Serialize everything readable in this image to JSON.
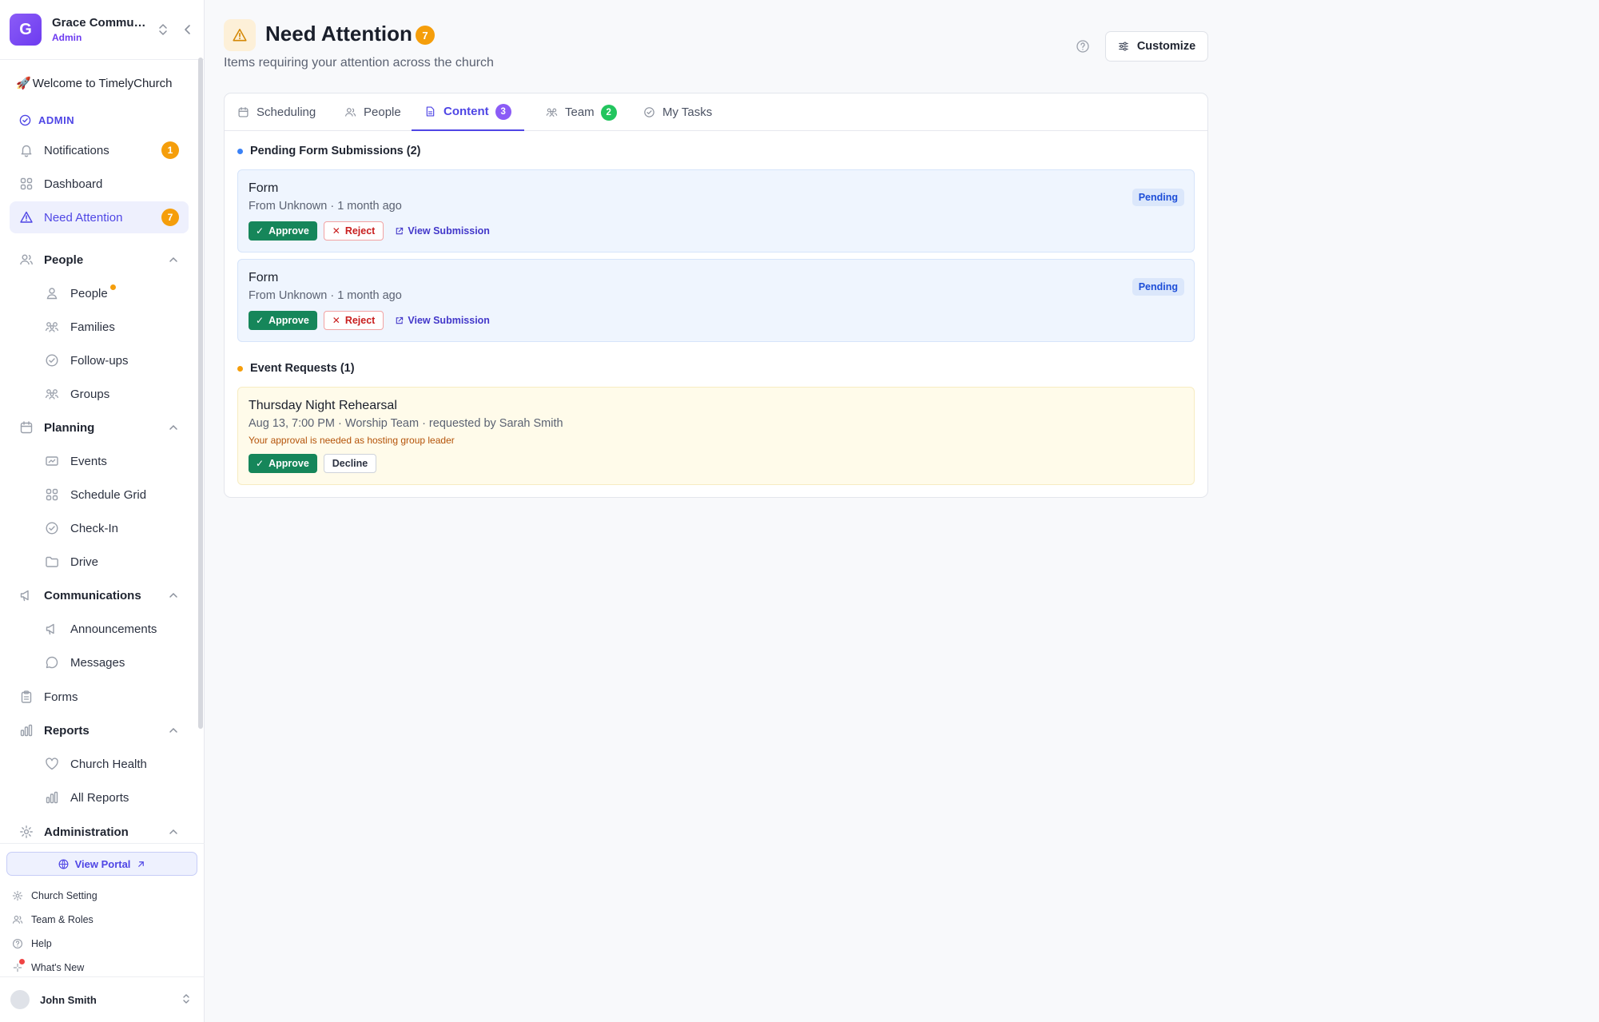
{
  "org": {
    "initial": "G",
    "name": "Grace Community Church",
    "role": "Admin"
  },
  "sidebar": {
    "welcome": "Welcome to TimelyChurch",
    "section_label": "ADMIN",
    "items": {
      "notifications": {
        "label": "Notifications",
        "badge": "1"
      },
      "dashboard": {
        "label": "Dashboard"
      },
      "need_attention": {
        "label": "Need Attention",
        "badge": "7"
      },
      "people_group": {
        "label": "People"
      },
      "people": {
        "label": "People"
      },
      "families": {
        "label": "Families"
      },
      "followups": {
        "label": "Follow-ups"
      },
      "groups": {
        "label": "Groups"
      },
      "planning_group": {
        "label": "Planning"
      },
      "events": {
        "label": "Events"
      },
      "schedule_grid": {
        "label": "Schedule Grid"
      },
      "checkin": {
        "label": "Check-In"
      },
      "drive": {
        "label": "Drive"
      },
      "communications_group": {
        "label": "Communications"
      },
      "announcements": {
        "label": "Announcements"
      },
      "messages": {
        "label": "Messages"
      },
      "forms": {
        "label": "Forms"
      },
      "reports_group": {
        "label": "Reports"
      },
      "church_health": {
        "label": "Church Health"
      },
      "all_reports": {
        "label": "All Reports"
      },
      "administration_group": {
        "label": "Administration"
      }
    },
    "footer": {
      "view_portal": "View Portal",
      "church_setting": "Church Setting",
      "team_roles": "Team & Roles",
      "help": "Help",
      "whats_new": "What's New"
    },
    "user": {
      "name": "John Smith"
    }
  },
  "header": {
    "title": "Need Attention",
    "badge": "7",
    "subtitle": "Items requiring your attention across the church",
    "customize_label": "Customize"
  },
  "tabs": [
    {
      "label": "Scheduling"
    },
    {
      "label": "People"
    },
    {
      "label": "Content",
      "badge": "3"
    },
    {
      "label": "Team",
      "badge": "2"
    },
    {
      "label": "My Tasks"
    }
  ],
  "sections": {
    "forms": {
      "heading": "Pending Form Submissions (2)",
      "items": [
        {
          "title": "Form",
          "meta": "From Unknown · 1 month ago",
          "status": "Pending",
          "approve": "Approve",
          "reject": "Reject",
          "view": "View Submission"
        },
        {
          "title": "Form",
          "meta": "From Unknown · 1 month ago",
          "status": "Pending",
          "approve": "Approve",
          "reject": "Reject",
          "view": "View Submission"
        }
      ]
    },
    "events": {
      "heading": "Event Requests (1)",
      "items": [
        {
          "title": "Thursday Night Rehearsal",
          "meta": "Aug 13, 7:00 PM · Worship Team · requested by Sarah Smith",
          "note": "Your approval is needed as hosting group leader",
          "approve": "Approve",
          "decline": "Decline"
        }
      ]
    }
  },
  "colors": {
    "accent": "#4f46e5",
    "warning": "#f59e0b",
    "success": "#16865a",
    "danger": "#c81e1e",
    "team_badge": "#22c55e",
    "content_badge": "#8b5cf6"
  }
}
